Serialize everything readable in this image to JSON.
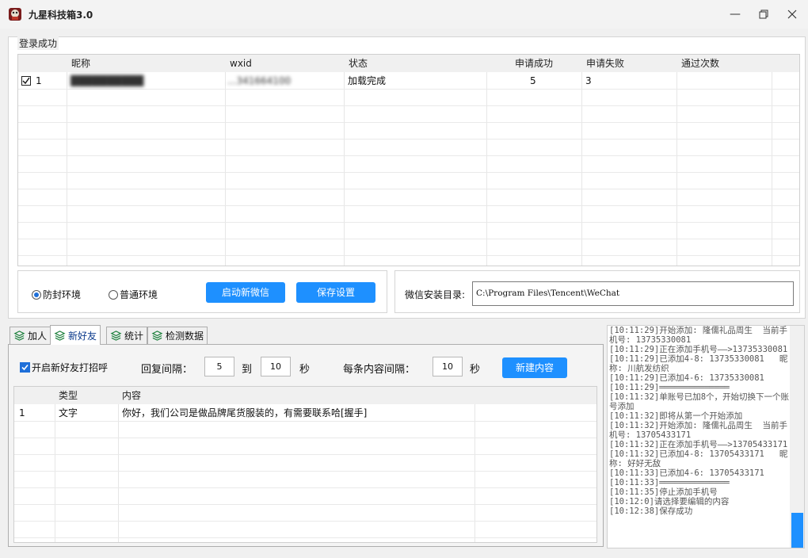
{
  "window": {
    "title": "九星科技箱3.0"
  },
  "login": {
    "legend": "登录成功",
    "columns": [
      "昵称",
      "wxid",
      "状态",
      "申请成功",
      "申请失败",
      "通过次数"
    ],
    "rows": [
      {
        "checked": true,
        "index": "1",
        "nickname": "██████████",
        "wxid": "...341664100",
        "status": "加载完成",
        "success": "5",
        "fail": "3",
        "passes": ""
      }
    ]
  },
  "env": {
    "options": [
      "防封环境",
      "普通环境"
    ],
    "selected": "防封环境",
    "start_button": "启动新微信",
    "save_button": "保存设置"
  },
  "install": {
    "label": "微信安装目录:",
    "path": "C:\\Program Files\\Tencent\\WeChat"
  },
  "tabs": [
    {
      "label": "加人",
      "active": false
    },
    {
      "label": "新好友",
      "active": true
    },
    {
      "label": "统计",
      "active": false
    },
    {
      "label": "检测数据",
      "active": false
    }
  ],
  "greeting": {
    "enable_label": "开启新好友打招呼",
    "enabled": true,
    "reply_interval_label": "回复间隔：",
    "reply_from": "5",
    "to_label": "到",
    "reply_to": "10",
    "seconds_label": "秒",
    "content_interval_label": "每条内容间隔：",
    "content_interval": "10",
    "seconds_label2": "秒",
    "new_button": "新建内容",
    "columns": [
      "类型",
      "内容"
    ],
    "rows": [
      {
        "index": "1",
        "type": "文字",
        "content": "你好，我们公司是做品牌尾货服装的，有需要联系哈[握手]"
      }
    ]
  },
  "log": {
    "text": "[10:11:29]开始添加: 隆儒礼品周生  当前手机号: 13735330081\n[10:11:29]正在添加手机号——>13735330081\n[10:11:29]已添加4-8: 13735330081   昵称: 川航发纺织\n[10:11:29]已添加4-6: 13735330081\n[10:11:29]══════════════\n[10:11:32]单账号已加8个，开始切换下一个账号添加\n[10:11:32]即将从第一个开始添加\n[10:11:32]开始添加: 隆儒礼品周生  当前手机号: 13705433171\n[10:11:32]正在添加手机号——>13705433171\n[10:11:32]已添加4-8: 13705433171   昵称: 好好无敌\n[10:11:33]已添加4-6: 13705433171\n[10:11:33]══════════════\n[10:11:35]停止添加手机号\n[10:12:0]请选择要编辑的内容\n[10:12:38]保存成功"
  }
}
